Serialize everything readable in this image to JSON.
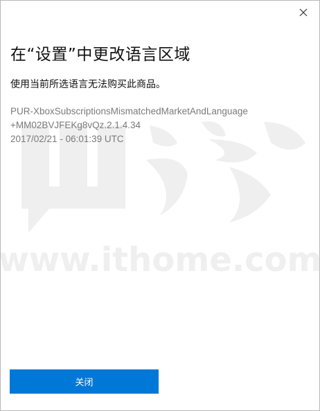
{
  "dialog": {
    "title": "在“设置”中更改语言区域",
    "message": "使用当前所选语言无法购买此商品。",
    "error_code_line1": "PUR-XboxSubscriptionsMismatchedMarketAndLanguage",
    "error_code_line2": "+MM02BVJFEKg8vQz.2.1.4.34",
    "timestamp": "2017/02/21 - 06:01:39 UTC",
    "close_label": "关闭"
  },
  "icons": {
    "close": "close-icon"
  },
  "colors": {
    "accent": "#0078d7",
    "text": "#111111",
    "secondary_text": "#7a7a7a"
  }
}
